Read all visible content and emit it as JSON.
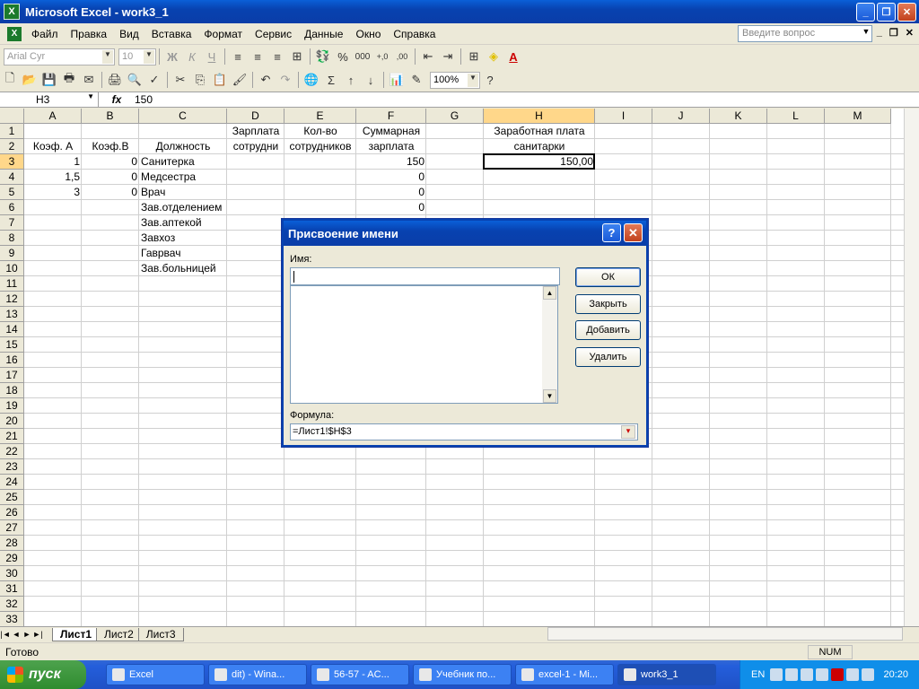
{
  "window": {
    "title": "Microsoft Excel - work3_1",
    "app_icon": "excel-icon"
  },
  "menu": {
    "items": [
      "Файл",
      "Правка",
      "Вид",
      "Вставка",
      "Формат",
      "Сервис",
      "Данные",
      "Окно",
      "Справка"
    ],
    "ask_placeholder": "Введите вопрос"
  },
  "toolbar": {
    "font": "Arial Cyr",
    "size": "10",
    "zoom": "100%"
  },
  "formula_bar": {
    "cell_ref": "H3",
    "fx": "fx",
    "value": "150"
  },
  "grid": {
    "columns": [
      "A",
      "B",
      "C",
      "D",
      "E",
      "F",
      "G",
      "H",
      "I",
      "J",
      "K",
      "L",
      "M"
    ],
    "rows": [
      "1",
      "2",
      "3",
      "4",
      "5",
      "6",
      "7",
      "8",
      "9",
      "10",
      "11",
      "12",
      "13",
      "14",
      "15",
      "16",
      "17",
      "18",
      "19",
      "20",
      "21",
      "22",
      "23",
      "24",
      "25",
      "26",
      "27",
      "28",
      "29",
      "30",
      "31",
      "32",
      "33"
    ],
    "selected_cell": "H3",
    "cells": {
      "A2": "Коэф. А",
      "B2": "Коэф.В",
      "C2": "Должность",
      "D1": "Зарплата",
      "D2": "сотрудни",
      "E1": "Кол-во",
      "E2": "сотрудников",
      "F1": "Суммарная",
      "F2": "зарплата",
      "H1": "Заработная плата",
      "H2": "санитарки",
      "A3": "1",
      "B3": "0",
      "C3": "Санитерка",
      "F3": "150",
      "H3": "150,00",
      "A4": "1,5",
      "B4": "0",
      "C4": "Медсестра",
      "F4": "0",
      "A5": "3",
      "B5": "0",
      "C5": "Врач",
      "F5": "0",
      "C6": "Зав.отделением",
      "F6": "0",
      "C7": "Зав.аптекой",
      "C8": "Завхоз",
      "C9": "Гаврвач",
      "C10": "Зав.больницей"
    }
  },
  "sheets": {
    "tabs": [
      "Лист1",
      "Лист2",
      "Лист3"
    ],
    "active": "Лист1"
  },
  "status": {
    "left": "Готово",
    "num": "NUM"
  },
  "dialog": {
    "title": "Присвоение имени",
    "name_label": "Имя:",
    "name_value": "",
    "formula_label": "Формула:",
    "formula_value": "=Лист1!$H$3",
    "buttons": {
      "ok": "ОК",
      "close": "Закрыть",
      "add": "Добавить",
      "delete": "Удалить"
    }
  },
  "taskbar": {
    "start": "пуск",
    "tasks": [
      "Excel",
      "dit) - Wina...",
      "56-57 - AC...",
      "Учебник по...",
      "excel-1 - Mi...",
      "work3_1"
    ],
    "active_task": "work3_1",
    "lang": "EN",
    "clock": "20:20"
  }
}
